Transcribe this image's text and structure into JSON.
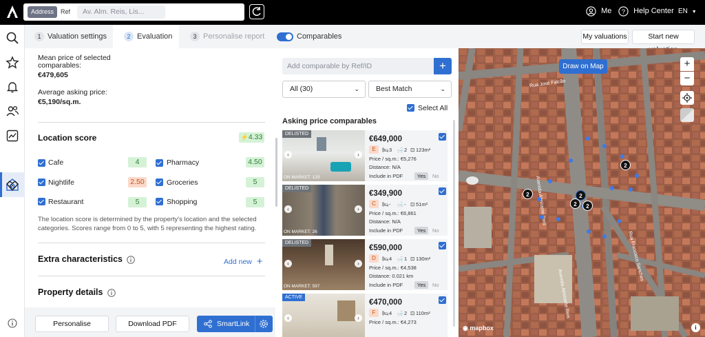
{
  "topbar": {
    "search_mode_active": "Address",
    "search_mode_other": "Ref",
    "address_placeholder": "Av. Alm. Reis, Lis...",
    "user_label": "Me",
    "help_label": "Help Center",
    "language": "EN"
  },
  "tabs": [
    {
      "num": "1",
      "label": "Valuation settings"
    },
    {
      "num": "2",
      "label": "Evaluation"
    },
    {
      "num": "3",
      "label": "Personalise report"
    }
  ],
  "comparables_toggle_label": "Comparables",
  "my_valuations_label": "My valuations",
  "start_new_label": "Start new valuation",
  "left": {
    "mean_price_label": "Mean price of selected comparables:",
    "mean_price_value": "€479,605",
    "avg_asking_label": "Average asking price:",
    "avg_asking_value": "€5,190/sq.m.",
    "location_score_title": "Location score",
    "location_score_value": "4.33",
    "amenities": [
      {
        "name": "Cafe",
        "score": "4"
      },
      {
        "name": "Pharmacy",
        "score": "4.50"
      },
      {
        "name": "Nightlife",
        "score": "2.50"
      },
      {
        "name": "Groceries",
        "score": "5"
      },
      {
        "name": "Restaurant",
        "score": "5"
      },
      {
        "name": "Shopping",
        "score": "5"
      }
    ],
    "location_note": "The location score is determined by the property's location and the selected categories. Scores range from 0 to 5, with 5 representing the highest rating.",
    "extra_title": "Extra characteristics",
    "add_new_label": "Add new",
    "property_details_title": "Property details"
  },
  "footer": {
    "personalise": "Personalise",
    "download_pdf": "Download PDF",
    "smartlink": "SmartLink"
  },
  "middle": {
    "add_comparable_placeholder": "Add comparable by Ref/ID",
    "filter_value": "All (30)",
    "sort_value": "Best Match",
    "select_all_label": "Select All",
    "section_title": "Asking price comparables",
    "cards": [
      {
        "status": "DELISTED",
        "on_market": "ON MARKET: 129",
        "price": "€649,000",
        "grade": "E",
        "beds": "3",
        "baths": "2",
        "area": "123m²",
        "price_sqm": "Price / sq.m.: €5,276",
        "distance": "Distance: N/A",
        "include": "Include in PDF",
        "yes": "Yes",
        "no": "No"
      },
      {
        "status": "DELISTED",
        "on_market": "ON MARKET: 26",
        "price": "€349,900",
        "grade": "C",
        "beds": "-",
        "baths": "-",
        "area": "51m²",
        "price_sqm": "Price / sq.m.: €6,861",
        "distance": "Distance: N/A",
        "include": "Include in PDF",
        "yes": "Yes",
        "no": "No"
      },
      {
        "status": "DELISTED",
        "on_market": "ON MARKET: 597",
        "price": "€590,000",
        "grade": "D",
        "beds": "4",
        "baths": "1",
        "area": "130m²",
        "price_sqm": "Price / sq.m.: €4,538",
        "distance": "Distance: 0.021 km",
        "include": "Include in PDF",
        "yes": "Yes",
        "no": "No"
      },
      {
        "status": "ACTIVE",
        "on_market": "",
        "price": "€470,000",
        "grade": "F",
        "beds": "4",
        "baths": "2",
        "area": "110m²",
        "price_sqm": "Price / sq.m.: €4,273",
        "distance": "",
        "include": "",
        "yes": "",
        "no": ""
      }
    ]
  },
  "map": {
    "draw_label": "Draw on Map",
    "attribution": "mapbox",
    "street_labels": [
      "Rua José Falcão",
      "Avenida Almirante Reis",
      "Rua Francisco Sanches",
      "Avenida Almirante Reis"
    ],
    "cluster_pins": [
      "2",
      "2",
      "2",
      "2",
      "2"
    ]
  },
  "colors": {
    "accent": "#2f6fd1",
    "score_green_bg": "#d5f2d6",
    "score_orange_bg": "#fbd9c9"
  }
}
